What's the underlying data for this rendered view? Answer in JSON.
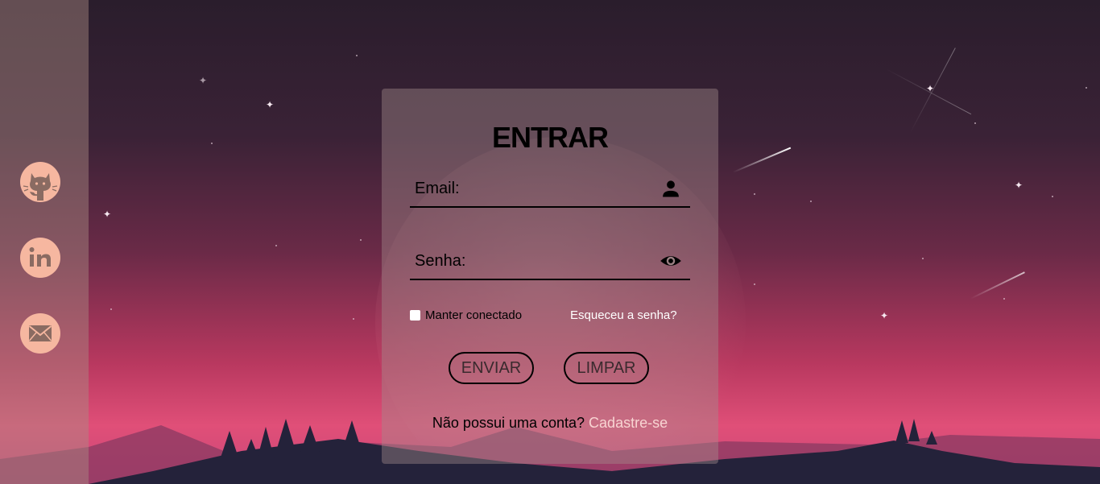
{
  "login": {
    "title": "ENTRAR",
    "email_placeholder": "Email:",
    "password_placeholder": "Senha:",
    "remember_label": "Manter conectado",
    "forgot_label": "Esqueceu a senha?",
    "submit_label": "ENVIAR",
    "clear_label": "LIMPAR",
    "no_account_text": "Não possui uma conta?",
    "signup_link": "Cadastre-se"
  },
  "sidebar": {
    "links": [
      {
        "icon": "github-icon"
      },
      {
        "icon": "linkedin-icon"
      },
      {
        "icon": "mail-icon"
      }
    ]
  },
  "colors": {
    "social_bg": "#f6b7a0",
    "card_bg": "rgba(165,140,140,0.42)",
    "signup_link": "#f8d4d2"
  }
}
